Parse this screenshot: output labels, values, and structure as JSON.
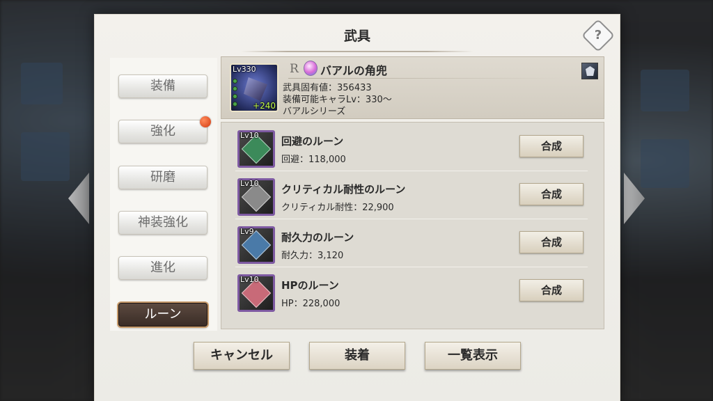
{
  "dialog": {
    "title": "武具",
    "help_label": "?"
  },
  "tabs": [
    {
      "label": "装備",
      "active": false,
      "badge": false
    },
    {
      "label": "強化",
      "active": false,
      "badge": true
    },
    {
      "label": "研磨",
      "active": false,
      "badge": false
    },
    {
      "label": "神装強化",
      "active": false,
      "badge": false
    },
    {
      "label": "進化",
      "active": false,
      "badge": false
    },
    {
      "label": "ルーン",
      "active": true,
      "badge": false
    }
  ],
  "weapon": {
    "level": "Lv330",
    "plus": "+240",
    "rarity": "R",
    "name": "バアルの角兜",
    "stats": [
      "武具固有値：356433",
      "装備可能キャラLv：330〜",
      "バアルシリーズ"
    ]
  },
  "runes": [
    {
      "level": "Lv10",
      "name": "回避のルーン",
      "stat": "回避：118,000",
      "button": "合成",
      "color": "#3c8a5a"
    },
    {
      "level": "Lv10",
      "name": "クリティカル耐性のルーン",
      "stat": "クリティカル耐性：22,900",
      "button": "合成",
      "color": "#8a8a8a"
    },
    {
      "level": "Lv9",
      "name": "耐久力のルーン",
      "stat": "耐久力：3,120",
      "button": "合成",
      "color": "#4a7aa8"
    },
    {
      "level": "Lv10",
      "name": "HPのルーン",
      "stat": "HP：228,000",
      "button": "合成",
      "color": "#c86a78"
    }
  ],
  "footer": {
    "cancel_label": "キャンセル",
    "equip_label": "装着",
    "list_label": "一覧表示"
  }
}
